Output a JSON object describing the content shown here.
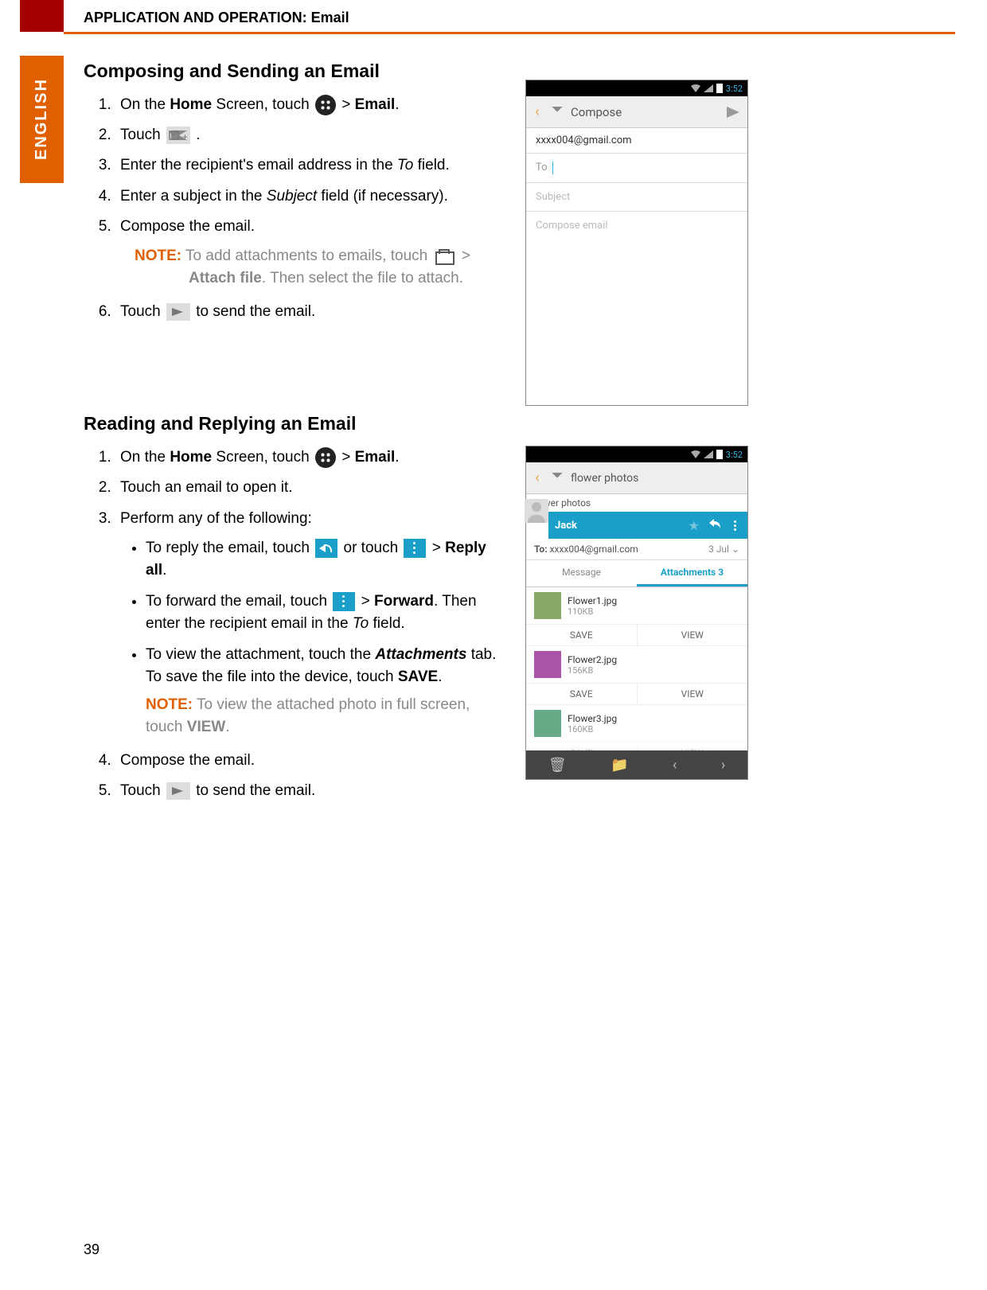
{
  "header": {
    "title": "APPLICATION AND OPERATION: Email",
    "side_tab": "ENGLISH"
  },
  "section1": {
    "heading": "Composing and Sending an Email",
    "step1_a": "On the ",
    "step1_home": "Home",
    "step1_b": " Screen, touch ",
    "step1_c": "  > ",
    "step1_email": "Email",
    "step1_d": ".",
    "step2_a": "Touch ",
    "step2_b": ".",
    "step3_a": "Enter the recipient's email address in the ",
    "step3_to": "To",
    "step3_b": " field.",
    "step4_a": "Enter a subject in the ",
    "step4_subj": "Subject",
    "step4_b": " field (if necessary).",
    "step5": "Compose the email.",
    "note_label": "NOTE:",
    "note_a": " To add attachments to emails, touch ",
    "note_b": " > ",
    "note_attach": "Attach file",
    "note_c": ". Then select the file to attach.",
    "step6_a": "Touch ",
    "step6_b": " to send the email."
  },
  "section2": {
    "heading": "Reading and Replying an Email",
    "step1_a": "On the ",
    "step1_home": "Home",
    "step1_b": " Screen, touch ",
    "step1_c": "  > ",
    "step1_email": "Email",
    "step1_d": ".",
    "step2": "Touch an email to open it.",
    "step3": "Perform any of the following:",
    "b1_a": "To reply the email, touch ",
    "b1_b": " or touch ",
    "b1_c": " > ",
    "b1_replyall": "Reply all",
    "b1_d": ".",
    "b2_a": "To forward the email, touch ",
    "b2_b": " > ",
    "b2_fwd": "Forward",
    "b2_c": ". Then enter the recipient email in the ",
    "b2_to": "To",
    "b2_d": " field.",
    "b3_a": "To view the attachment, touch the ",
    "b3_att": "Attachments",
    "b3_b": " tab. To save the file into the device, touch ",
    "b3_save": "SAVE",
    "b3_c": ".",
    "note_label": "NOTE:",
    "note_a": " To view the attached photo in full screen, touch ",
    "note_view": "VIEW",
    "note_b": ".",
    "step4": "Compose the email.",
    "step5_a": "Touch ",
    "step5_b": " to send the email."
  },
  "phone1": {
    "time": "3:52",
    "ab_title": "Compose",
    "from": "xxxx004@gmail.com",
    "to_label": "To",
    "subject_ph": "Subject",
    "body_ph": "Compose email"
  },
  "phone2": {
    "time": "3:52",
    "ab_title": "flower photos",
    "subject": "flower photos",
    "sender": "Jack",
    "to_label": "To:",
    "to_value": "xxxx004@gmail.com",
    "date": "3 Jul",
    "tab_msg": "Message",
    "tab_att": "Attachments 3",
    "attachments": [
      {
        "name": "Flower1.jpg",
        "size": "110KB"
      },
      {
        "name": "Flower2.jpg",
        "size": "156KB"
      },
      {
        "name": "Flower3.jpg",
        "size": "160KB"
      }
    ],
    "btn_save": "SAVE",
    "btn_view": "VIEW"
  },
  "page_number": "39"
}
